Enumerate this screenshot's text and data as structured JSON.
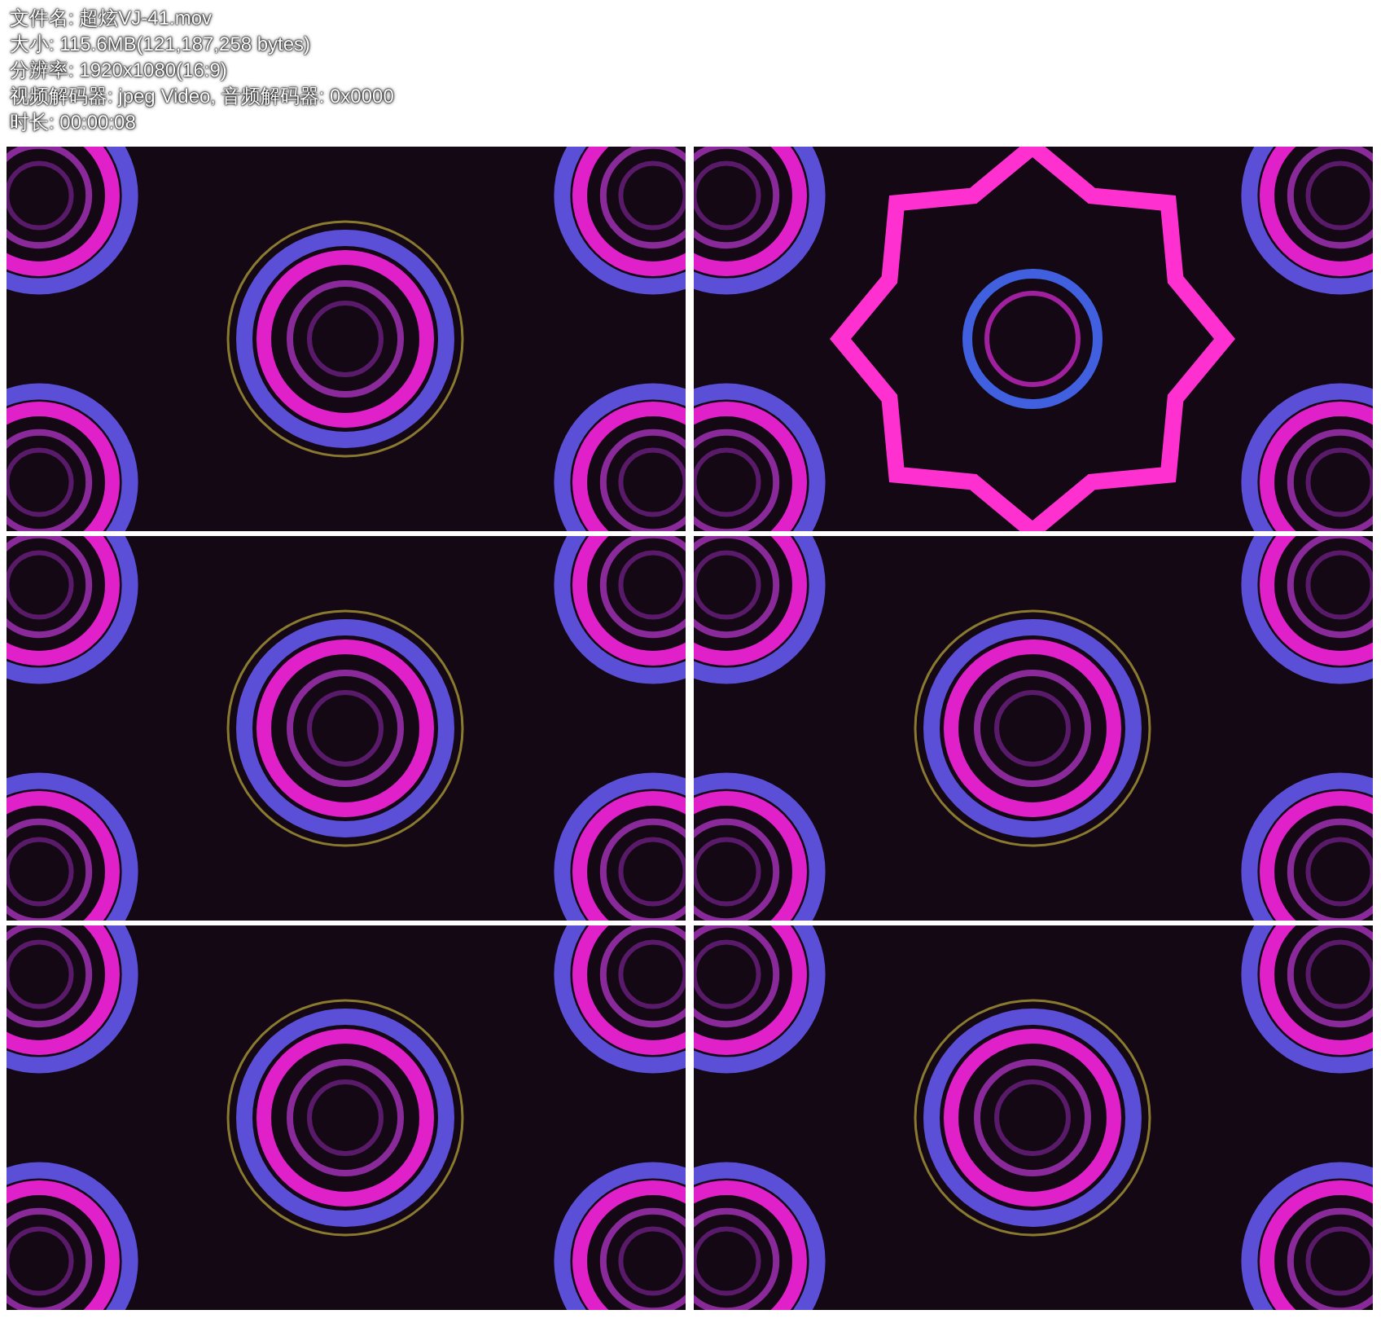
{
  "info_lines": [
    "文件名: 超炫VJ-41.mov",
    "大小: 115.6MB(121,187,258 bytes)",
    "分辨率: 1920x1080(16:9)",
    "视频解码器: jpeg Video, 音频解码器: 0x0000",
    "时长: 00:00:08"
  ],
  "frames": [
    {
      "kind": "rings"
    },
    {
      "kind": "star"
    },
    {
      "kind": "rings"
    },
    {
      "kind": "rings"
    },
    {
      "kind": "rings"
    },
    {
      "kind": "rings"
    }
  ]
}
